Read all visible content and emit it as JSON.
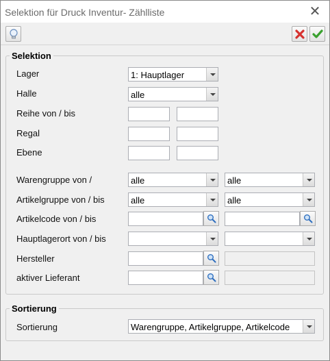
{
  "window": {
    "title": "Selektion für Druck Inventur- Zählliste"
  },
  "selektion": {
    "title": "Selektion",
    "labels": {
      "lager": "Lager",
      "halle": "Halle",
      "reihe": "Reihe von / bis",
      "regal": "Regal",
      "ebene": "Ebene",
      "warengruppe": "Warengruppe von /",
      "artikelgruppe": "Artikelgruppe von / bis",
      "artikelcode": "Artikelcode von / bis",
      "hauptlagerort": "Hauptlagerort von / bis",
      "hersteller": "Hersteller",
      "lieferant": "aktiver Lieferant"
    },
    "values": {
      "lager": "1: Hauptlager",
      "halle": "alle",
      "warengruppe_von": "alle",
      "warengruppe_bis": "alle",
      "artikelgruppe_von": "alle",
      "artikelgruppe_bis": "alle"
    }
  },
  "sortierung": {
    "title": "Sortierung",
    "label": "Sortierung",
    "value": "Warengruppe, Artikelgruppe, Artikelcode"
  },
  "icons": [
    "close-icon",
    "lightbulb-icon",
    "cancel-icon",
    "checkmark-icon",
    "search-icon",
    "chevron-down-icon"
  ],
  "colors": {
    "cancel": "#d6322f",
    "confirm": "#3aa12f",
    "search": "#2f6fbf"
  }
}
